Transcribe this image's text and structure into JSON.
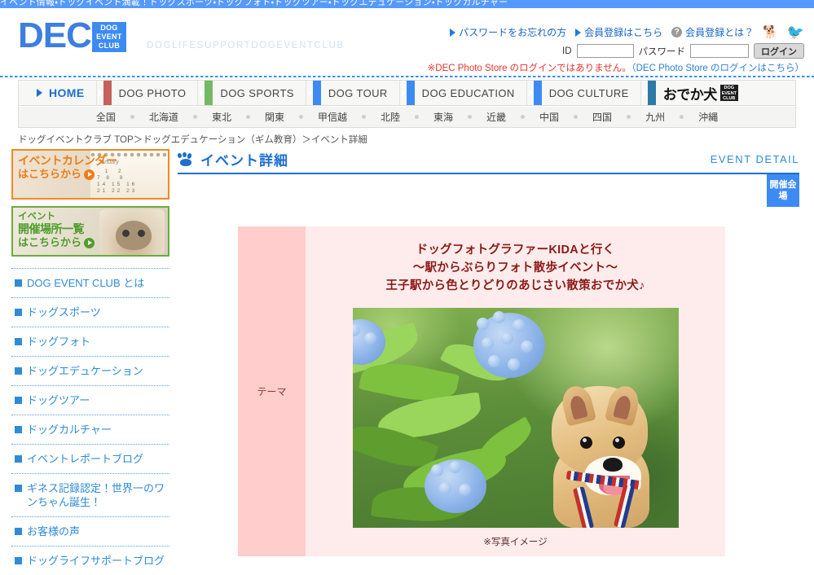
{
  "topstrip": {
    "text": "イベント情報・ドッグイベント満載！ドッグスポーツ・ドッグフォト・ドッグツアー・ドッグエデュケーション・ドッグカルチャー"
  },
  "header": {
    "logo_text": "DEC",
    "logo_badge_lines": [
      "DOG",
      "EVENT",
      "CLUB"
    ],
    "tagline": "DOGLIFESUPPORTDOGEVENTCLUB",
    "links": [
      {
        "label": "パスワードをお忘れの方",
        "icon": "triangle-right-icon"
      },
      {
        "label": "会員登録はこちら",
        "icon": "triangle-right-icon"
      },
      {
        "label": "会員登録とは？",
        "icon": "question-mark-icon"
      }
    ],
    "dog_icon": "dog-icon",
    "twitter_icon": "twitter-bird-icon",
    "login": {
      "id_label": "ID",
      "id_value": "",
      "id_placeholder": "",
      "pw_label": "パスワード",
      "pw_value": "",
      "pw_placeholder": "",
      "button_label": "ログイン"
    },
    "notice_red": "※DEC Photo Store のログインではありません。",
    "notice_link": "（DEC Photo Store のログインはこちら）"
  },
  "mainnav": {
    "items": [
      {
        "label": "HOME",
        "accent": "",
        "active": true
      },
      {
        "label": "DOG PHOTO",
        "accent": "#c4625c",
        "active": false
      },
      {
        "label": "DOG SPORTS",
        "accent": "#74ba63",
        "active": false
      },
      {
        "label": "DOG TOUR",
        "accent": "#3d8bf2",
        "active": false
      },
      {
        "label": "DOG EDUCATION",
        "accent": "#3d8bf2",
        "active": false
      },
      {
        "label": "DOG CULTURE",
        "accent": "#3d8bf2",
        "active": false
      }
    ],
    "odekaken": {
      "label": "おでか犬",
      "badge_lines": [
        "DOG",
        "EVENT",
        "CLUB"
      ],
      "accent": "#2b7aa8"
    }
  },
  "regionnav": {
    "items": [
      "全国",
      "北海道",
      "東北",
      "関東",
      "甲信越",
      "北陸",
      "東海",
      "近畿",
      "中国",
      "四国",
      "九州",
      "沖縄"
    ]
  },
  "breadcrumb": {
    "text": "ドッグイベントクラブ TOP＞ドッグエデュケーション（ギム教育）＞イベント詳細"
  },
  "sidebar": {
    "banners": [
      {
        "line0": "",
        "line1": "イベントカレンダー",
        "line2": "はこちらから",
        "accent": "#f08a24",
        "type": "calendar-banner"
      },
      {
        "line0": "イベント",
        "line1": "開催場所一覧",
        "line2": "はこちらから",
        "accent": "#6aad3d",
        "type": "venue-list-banner"
      }
    ],
    "menu": [
      "DOG EVENT CLUB とは",
      "ドッグスポーツ",
      "ドッグフォト",
      "ドッグエデュケーション",
      "ドッグツアー",
      "ドッグカルチャー",
      "イベントレポートブログ",
      "ギネス記録認定！世界一のワンちゃん誕生！",
      "お客様の声",
      "ドッグライフサポートブログ"
    ]
  },
  "content": {
    "section_title": "イベント詳細",
    "section_title_en": "EVENT DETAIL",
    "venue_button": "開催会場",
    "theme_label": "テーマ",
    "event_title_lines": [
      "ドッグフォトグラファーKIDAと行く",
      "～駅からぶらりフォト散歩イベント～",
      "王子駅から色とりどりのあじさい散策おでか犬♪"
    ],
    "photo_caption": "※写真イメージ",
    "photo_alt": "あじさいと柴犬の写真"
  }
}
